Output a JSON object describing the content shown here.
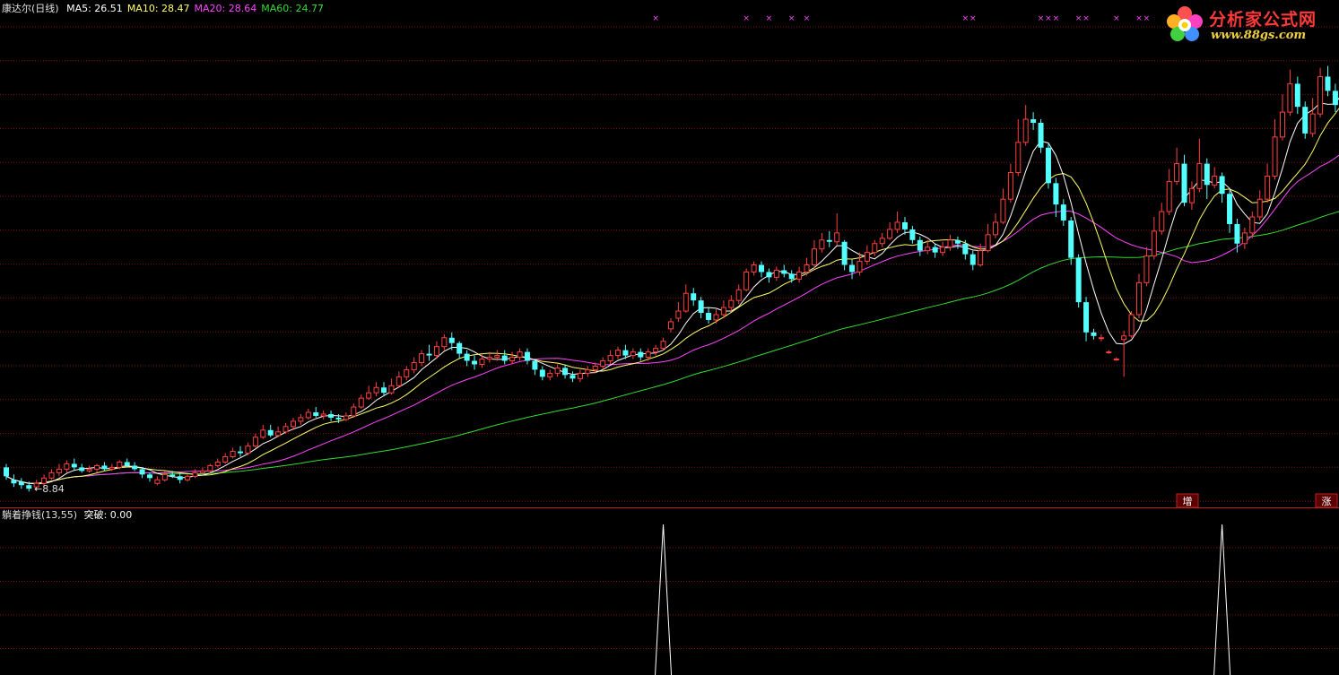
{
  "header": {
    "stock_name": "康达尔(日线)",
    "ma_items": [
      {
        "label": "MA5: 26.51",
        "color": "#ffffff"
      },
      {
        "label": "MA10: 28.47",
        "color": "#ffff66"
      },
      {
        "label": "MA20: 28.64",
        "color": "#ff44ff"
      },
      {
        "label": "MA60: 24.77",
        "color": "#33dd33"
      }
    ]
  },
  "indicator_header": {
    "name": "躺着挣钱(13,55)",
    "value_label": "突破: 0.00"
  },
  "markers": {
    "low_price_label": "←8.84",
    "box_label_1": "增",
    "box_label_2": "涨",
    "top_symbol": "×"
  },
  "logo": {
    "title": "分析家公式网",
    "url": "www.88gs.com"
  },
  "colors": {
    "up": "#ff4040",
    "down": "#54ffff",
    "ma5": "#ffffff",
    "ma10": "#ffff66",
    "ma20": "#ff44ff",
    "ma60": "#33dd33",
    "grid": "#7a1414",
    "divider": "#c02020",
    "signal": "#ffffff",
    "marker": "#ff44ff"
  },
  "chart_data": {
    "type": "candlestick",
    "title": "康达尔(日线)",
    "price_range": [
      8.0,
      35.0
    ],
    "grid": true,
    "candles": [
      [
        10.2,
        9.7,
        10.4,
        9.5
      ],
      [
        9.5,
        9.3,
        9.8,
        9.1
      ],
      [
        9.4,
        9.2,
        9.6,
        9.0
      ],
      [
        9.2,
        9.0,
        9.4,
        8.84
      ],
      [
        9.1,
        9.3,
        9.5,
        8.9
      ],
      [
        9.3,
        9.6,
        9.8,
        9.1
      ],
      [
        9.6,
        9.9,
        10.1,
        9.5
      ],
      [
        9.9,
        10.1,
        10.4,
        9.7
      ],
      [
        10.1,
        10.4,
        10.6,
        9.9
      ],
      [
        10.4,
        10.2,
        10.7,
        10.0
      ],
      [
        10.2,
        10.0,
        10.4,
        9.9
      ],
      [
        10.0,
        10.1,
        10.3,
        9.9
      ],
      [
        10.1,
        10.3,
        10.4,
        9.9
      ],
      [
        10.3,
        10.1,
        10.5,
        10.0
      ],
      [
        10.1,
        10.2,
        10.4,
        10.0
      ],
      [
        10.2,
        10.5,
        10.6,
        10.1
      ],
      [
        10.5,
        10.3,
        10.7,
        10.2
      ],
      [
        10.3,
        10.1,
        10.5,
        10.0
      ],
      [
        10.1,
        9.8,
        10.2,
        9.6
      ],
      [
        9.8,
        9.6,
        9.9,
        9.4
      ],
      [
        9.3,
        9.5,
        9.7,
        9.2
      ],
      [
        9.5,
        9.8,
        10.0,
        9.4
      ],
      [
        9.8,
        9.7,
        10.0,
        9.6
      ],
      [
        9.7,
        9.5,
        9.9,
        9.3
      ],
      [
        9.5,
        9.7,
        9.8,
        9.4
      ],
      [
        9.7,
        9.9,
        10.1,
        9.6
      ],
      [
        9.9,
        10.0,
        10.2,
        9.8
      ],
      [
        10.0,
        10.3,
        10.4,
        9.9
      ],
      [
        10.3,
        10.5,
        10.7,
        10.2
      ],
      [
        10.5,
        10.8,
        11.0,
        10.4
      ],
      [
        10.8,
        11.1,
        11.3,
        10.7
      ],
      [
        11.1,
        11.0,
        11.4,
        10.8
      ],
      [
        11.0,
        11.4,
        11.6,
        10.9
      ],
      [
        11.4,
        11.9,
        12.1,
        11.3
      ],
      [
        11.9,
        12.3,
        12.6,
        11.8
      ],
      [
        12.3,
        12.0,
        12.6,
        11.9
      ],
      [
        12.0,
        12.2,
        12.5,
        11.9
      ],
      [
        12.2,
        12.5,
        12.7,
        12.1
      ],
      [
        12.5,
        12.8,
        13.0,
        12.3
      ],
      [
        12.8,
        13.0,
        13.2,
        12.6
      ],
      [
        13.0,
        13.3,
        13.5,
        12.9
      ],
      [
        13.3,
        13.1,
        13.6,
        13.0
      ],
      [
        13.1,
        13.2,
        13.4,
        12.9
      ],
      [
        13.2,
        13.0,
        13.4,
        12.8
      ],
      [
        13.0,
        12.9,
        13.2,
        12.7
      ],
      [
        12.9,
        13.1,
        13.3,
        12.8
      ],
      [
        13.1,
        13.6,
        13.8,
        13.0
      ],
      [
        13.6,
        14.1,
        14.3,
        13.5
      ],
      [
        14.1,
        14.4,
        14.8,
        14.0
      ],
      [
        14.4,
        14.7,
        15.0,
        14.2
      ],
      [
        14.7,
        14.4,
        15.0,
        14.2
      ],
      [
        14.4,
        14.8,
        15.2,
        14.3
      ],
      [
        14.8,
        15.3,
        15.6,
        14.7
      ],
      [
        15.3,
        15.7,
        15.9,
        15.1
      ],
      [
        15.7,
        16.1,
        16.4,
        15.5
      ],
      [
        16.1,
        16.6,
        16.8,
        15.9
      ],
      [
        16.6,
        16.5,
        17.1,
        16.2
      ],
      [
        16.5,
        17.0,
        17.3,
        16.3
      ],
      [
        17.0,
        17.5,
        17.7,
        16.8
      ],
      [
        17.5,
        17.2,
        17.8,
        16.8
      ],
      [
        17.2,
        16.6,
        17.3,
        16.3
      ],
      [
        16.6,
        16.2,
        16.8,
        15.9
      ],
      [
        16.2,
        16.0,
        16.5,
        15.7
      ],
      [
        16.0,
        16.3,
        16.6,
        15.8
      ],
      [
        16.3,
        16.4,
        16.7,
        16.1
      ],
      [
        16.4,
        16.5,
        16.8,
        16.2
      ],
      [
        16.5,
        16.2,
        16.8,
        16.0
      ],
      [
        16.2,
        16.4,
        16.7,
        16.0
      ],
      [
        16.4,
        16.7,
        16.9,
        16.2
      ],
      [
        16.7,
        16.2,
        16.9,
        16.0
      ],
      [
        16.2,
        15.7,
        16.3,
        15.4
      ],
      [
        15.7,
        15.3,
        15.9,
        15.1
      ],
      [
        15.3,
        15.5,
        15.7,
        15.1
      ],
      [
        15.5,
        15.8,
        16.0,
        15.3
      ],
      [
        15.8,
        15.4,
        16.0,
        15.2
      ],
      [
        15.4,
        15.2,
        15.6,
        15.0
      ],
      [
        15.2,
        15.5,
        15.7,
        15.0
      ],
      [
        15.5,
        15.7,
        15.9,
        15.3
      ],
      [
        15.7,
        15.9,
        16.1,
        15.5
      ],
      [
        15.9,
        16.2,
        16.4,
        15.7
      ],
      [
        16.2,
        16.5,
        16.8,
        16.0
      ],
      [
        16.5,
        16.8,
        17.0,
        16.3
      ],
      [
        16.8,
        16.5,
        17.1,
        16.3
      ],
      [
        16.5,
        16.7,
        16.9,
        16.3
      ],
      [
        16.7,
        16.4,
        16.9,
        16.2
      ],
      [
        16.4,
        16.7,
        16.9,
        16.2
      ],
      [
        16.7,
        16.9,
        17.1,
        16.5
      ],
      [
        16.9,
        17.3,
        17.5,
        16.8
      ],
      [
        18.0,
        18.4,
        18.6,
        17.8
      ],
      [
        18.6,
        19.0,
        19.5,
        18.4
      ],
      [
        19.0,
        20.0,
        20.5,
        18.9
      ],
      [
        20.0,
        19.6,
        20.3,
        19.3
      ],
      [
        19.6,
        18.9,
        19.8,
        18.6
      ],
      [
        18.9,
        18.5,
        19.2,
        18.3
      ],
      [
        18.5,
        18.8,
        19.1,
        18.3
      ],
      [
        18.8,
        19.2,
        19.6,
        18.6
      ],
      [
        19.2,
        19.6,
        19.9,
        19.0
      ],
      [
        19.6,
        20.2,
        20.5,
        19.4
      ],
      [
        20.2,
        21.2,
        21.4,
        20.1
      ],
      [
        21.2,
        21.6,
        21.8,
        21.0
      ],
      [
        21.6,
        21.2,
        21.8,
        20.9
      ],
      [
        21.2,
        20.9,
        21.4,
        20.6
      ],
      [
        20.9,
        21.3,
        21.5,
        20.7
      ],
      [
        21.3,
        21.1,
        21.6,
        20.9
      ],
      [
        21.1,
        20.8,
        21.3,
        20.6
      ],
      [
        20.8,
        21.2,
        21.5,
        20.6
      ],
      [
        21.2,
        21.6,
        22.0,
        21.0
      ],
      [
        21.6,
        22.5,
        23.0,
        21.4
      ],
      [
        22.5,
        23.0,
        23.4,
        22.3
      ],
      [
        23.0,
        22.9,
        23.5,
        22.6
      ],
      [
        22.9,
        23.4,
        24.5,
        22.7
      ],
      [
        22.9,
        21.6,
        23.0,
        21.3
      ],
      [
        21.6,
        21.2,
        21.9,
        20.8
      ],
      [
        21.2,
        21.8,
        22.3,
        21.0
      ],
      [
        21.8,
        22.3,
        22.7,
        21.6
      ],
      [
        22.3,
        22.8,
        23.0,
        22.1
      ],
      [
        22.8,
        23.1,
        23.4,
        22.6
      ],
      [
        23.1,
        23.6,
        24.0,
        23.0
      ],
      [
        23.6,
        24.0,
        24.6,
        23.4
      ],
      [
        24.0,
        23.6,
        24.3,
        23.3
      ],
      [
        23.6,
        23.0,
        23.8,
        22.8
      ],
      [
        23.0,
        22.4,
        23.2,
        22.1
      ],
      [
        22.4,
        22.6,
        23.0,
        22.2
      ],
      [
        22.6,
        22.3,
        22.8,
        22.0
      ],
      [
        22.3,
        22.6,
        22.9,
        22.1
      ],
      [
        22.6,
        23.0,
        23.3,
        22.4
      ],
      [
        23.0,
        22.8,
        23.2,
        22.5
      ],
      [
        22.8,
        22.2,
        23.0,
        21.9
      ],
      [
        22.2,
        21.6,
        22.4,
        21.3
      ],
      [
        21.6,
        22.4,
        22.8,
        21.5
      ],
      [
        22.4,
        23.3,
        23.9,
        22.3
      ],
      [
        23.3,
        24.0,
        24.5,
        23.1
      ],
      [
        24.0,
        25.3,
        25.9,
        23.9
      ],
      [
        25.3,
        26.8,
        27.3,
        25.1
      ],
      [
        26.8,
        28.5,
        29.8,
        26.6
      ],
      [
        28.5,
        29.8,
        30.6,
        28.3
      ],
      [
        29.8,
        29.6,
        30.2,
        29.2
      ],
      [
        29.6,
        28.2,
        29.8,
        27.9
      ],
      [
        28.2,
        26.2,
        28.4,
        25.9
      ],
      [
        26.2,
        25.0,
        26.5,
        24.3
      ],
      [
        25.0,
        24.1,
        25.3,
        23.8
      ],
      [
        24.1,
        22.0,
        24.3,
        21.6
      ],
      [
        22.0,
        19.5,
        22.2,
        19.2
      ],
      [
        19.5,
        17.8,
        19.8,
        17.3
      ],
      [
        17.8,
        17.6,
        18.0,
        17.4
      ],
      [
        17.5,
        17.5,
        17.7,
        17.3
      ],
      [
        16.7,
        16.7,
        16.8,
        16.6
      ],
      [
        16.3,
        16.3,
        16.4,
        16.2
      ],
      [
        17.4,
        17.6,
        17.9,
        15.3
      ],
      [
        17.6,
        18.8,
        19.0,
        17.5
      ],
      [
        18.8,
        20.6,
        21.1,
        18.6
      ],
      [
        20.6,
        22.1,
        22.6,
        20.4
      ],
      [
        22.1,
        23.5,
        24.3,
        21.9
      ],
      [
        23.5,
        24.6,
        25.1,
        23.3
      ],
      [
        24.6,
        26.3,
        27.0,
        24.4
      ],
      [
        26.3,
        27.3,
        28.2,
        26.1
      ],
      [
        27.3,
        25.1,
        27.8,
        24.9
      ],
      [
        25.1,
        25.9,
        26.3,
        24.7
      ],
      [
        25.9,
        27.3,
        28.7,
        25.7
      ],
      [
        27.3,
        26.1,
        27.6,
        25.3
      ],
      [
        26.1,
        26.6,
        27.1,
        25.9
      ],
      [
        26.6,
        25.6,
        26.8,
        25.1
      ],
      [
        25.6,
        23.9,
        25.8,
        23.4
      ],
      [
        23.9,
        22.8,
        24.2,
        22.3
      ],
      [
        22.8,
        23.4,
        23.7,
        22.5
      ],
      [
        23.4,
        24.3,
        24.6,
        23.1
      ],
      [
        24.3,
        25.3,
        25.8,
        24.1
      ],
      [
        25.3,
        26.6,
        27.3,
        25.1
      ],
      [
        26.6,
        28.8,
        29.8,
        26.4
      ],
      [
        28.8,
        30.2,
        31.2,
        28.6
      ],
      [
        30.2,
        31.8,
        32.6,
        30.0
      ],
      [
        31.8,
        30.5,
        32.2,
        30.1
      ],
      [
        30.5,
        29.0,
        30.8,
        28.7
      ],
      [
        29.0,
        30.1,
        31.0,
        28.8
      ],
      [
        30.1,
        32.2,
        32.7,
        29.9
      ],
      [
        32.2,
        31.4,
        32.8,
        31.1
      ],
      [
        31.4,
        30.6,
        31.8,
        30.2
      ],
      [
        30.6,
        32.4,
        33.0,
        30.4
      ],
      [
        32.4,
        31.4,
        32.7,
        30.9
      ]
    ],
    "ma_series": [
      {
        "name": "MA5",
        "last": 26.51
      },
      {
        "name": "MA10",
        "last": 28.47
      },
      {
        "name": "MA20",
        "last": 28.64
      },
      {
        "name": "MA60",
        "last": 24.77
      }
    ],
    "annotations": [
      {
        "text": "←8.84",
        "value": 8.84
      },
      {
        "text": "增"
      },
      {
        "text": "涨"
      }
    ],
    "indicator": {
      "name": "躺着挣钱(13,55)",
      "series": "突破",
      "last": 0.0,
      "range": [
        0,
        1
      ],
      "spikes": [
        {
          "bar": 87,
          "value": 1
        },
        {
          "bar": 161,
          "value": 1
        }
      ]
    }
  }
}
